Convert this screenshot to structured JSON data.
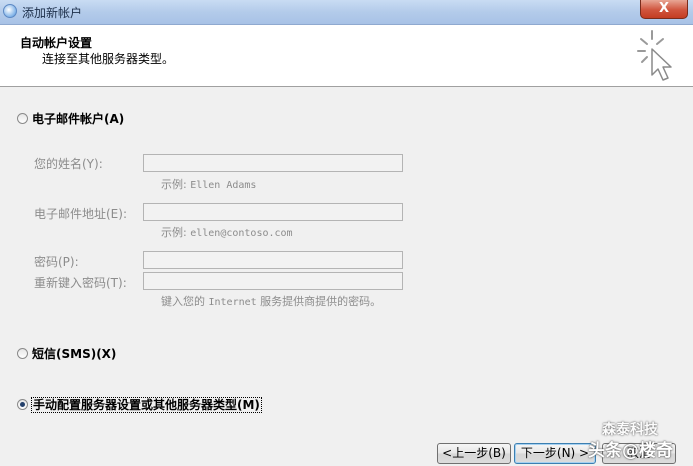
{
  "window": {
    "title": "添加新帐户",
    "close_label": "X"
  },
  "header": {
    "title": "自动帐户设置",
    "subtitle": "连接至其他服务器类型。"
  },
  "options": {
    "email": {
      "label": "电子邮件帐户(A)",
      "selected": false
    },
    "sms": {
      "label": "短信(SMS)(X)",
      "selected": false
    },
    "manual": {
      "label": "手动配置服务器设置或其他服务器类型(M)",
      "selected": true
    }
  },
  "fields": {
    "name": {
      "label": "您的姓名(Y):",
      "value": "",
      "hint_prefix": "示例:",
      "hint_example": "Ellen Adams"
    },
    "email": {
      "label": "电子邮件地址(E):",
      "value": "",
      "hint_prefix": "示例:",
      "hint_example": "ellen@contoso.com"
    },
    "password": {
      "label": "密码(P):",
      "value": ""
    },
    "retype_password": {
      "label": "重新键入密码(T):",
      "value": ""
    },
    "password_hint": {
      "prefix": "键入您的",
      "brand": "Internet",
      "suffix": "服务提供商提供的密码。"
    }
  },
  "buttons": {
    "back": "<上一步(B)",
    "next": "下一步(N) >",
    "cancel": "取消"
  },
  "watermark": {
    "line1": "森泰科技",
    "line2": "头条@楼奇"
  }
}
